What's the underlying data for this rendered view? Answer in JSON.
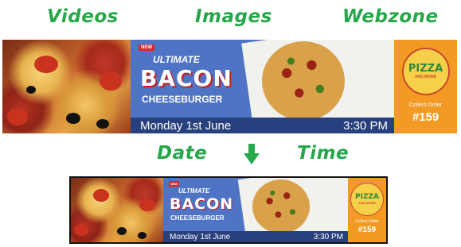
{
  "labels": {
    "videos": "Videos",
    "images": "Images",
    "webzone": "Webzone",
    "date": "Date",
    "time": "Time"
  },
  "promo": {
    "new_tag": "NEW",
    "line1": "ULTIMATE",
    "line2": "BACON",
    "line3": "CHEESEBURGER"
  },
  "date_bar": {
    "date": "Monday 1st June",
    "time": "3:30 PM"
  },
  "order": {
    "logo_main": "PIZZA",
    "logo_sub": "AND MORE",
    "label": "Collect Order",
    "number": "#159"
  },
  "icons": {
    "arrow": "arrow-down-icon"
  },
  "colors": {
    "label_green": "#25a74a",
    "promo_blue": "#4f74c5",
    "date_bar": "#28407e",
    "order_orange": "#f29a24"
  }
}
